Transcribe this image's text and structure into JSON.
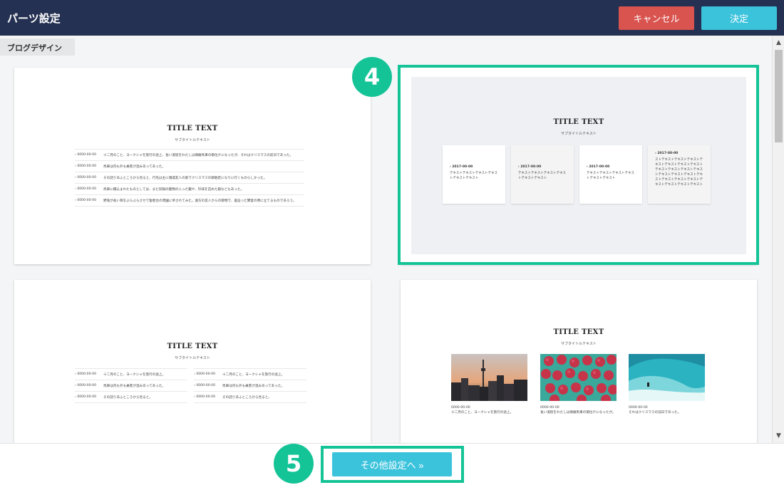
{
  "header": {
    "title": "パーツ設定",
    "cancel_label": "キャンセル",
    "ok_label": "決定"
  },
  "section": {
    "tab_label": "ブログデザイン"
  },
  "templates": {
    "title_text": "TITLE TEXT",
    "subtitle_text": "サブタイトルテキスト",
    "card1_rows": [
      {
        "date": "0000-00-00",
        "text": "十二月のこと、ヨークシャを旅行の途上、長い道程をわたしは頭痛馬車の御位介になったが、それはクリスマスの前日であった。"
      },
      {
        "date": "0000-00-00",
        "text": "馬車は内も外も乗客が混みあってあった。"
      },
      {
        "date": "0000-00-00",
        "text": "その話りあふところから見ると、行先は主に親戚友人の家でクリスマスの御馳走になりに行くものらしかった。"
      },
      {
        "date": "0000-00-00",
        "text": "馬車に積込まれたものとしては、また狩猟の獲物の入った籠や、珍味を詰めた箱などもあった。"
      },
      {
        "date": "0000-00-00",
        "text": "野兎が長い耳をぶらぶらさせて駆者台の周園に吊されてみた。遠方の友人からの贈物で、差迫った饗宴の用に立てるものであろう。"
      }
    ],
    "card2_items": [
      {
        "date": "2017-00-00",
        "text": "テキストテキストテキストテキストテキストテキスト"
      },
      {
        "date": "2017-00-00",
        "text": "テキストテキストテキストテキストテキストテキスト"
      },
      {
        "date": "2017-00-00",
        "text": "テキストテキストテキストテキストテキストテキスト"
      },
      {
        "date": "2017-00-00",
        "text": "ストテキストテキストテキストテキストテキストテキストテキストテキストテキストテキストテキストテキストテキストテキストテキストテキストテキストテキストテキストテキストテキストテキスト"
      }
    ],
    "card3_left": [
      {
        "date": "0000-00-00",
        "text": "十二月のこと、ヨークシャを旅行の途上。"
      },
      {
        "date": "0000-00-00",
        "text": "馬車は内も外も乗客が混みあってあった。"
      },
      {
        "date": "0000-00-00",
        "text": "その話りあふところから見ると。"
      }
    ],
    "card3_right": [
      {
        "date": "0000-00-00",
        "text": "十二月のこと、ヨークシャを旅行の途上。"
      },
      {
        "date": "0000-00-00",
        "text": "馬車は内も外も乗客が混みあってあった。"
      },
      {
        "date": "0000-00-00",
        "text": "その話りあふところから見ると。"
      }
    ],
    "card4_photos": [
      {
        "date": "0000-00-00",
        "text": "十二月のこと、ヨークシャを旅行の途上。",
        "image": "city-skyline-photo"
      },
      {
        "date": "0000-00-00",
        "text": "長い道程をわたしは頭痛馬車の御位介になったが。",
        "image": "raspberries-photo"
      },
      {
        "date": "0000-00-00",
        "text": "それはクリスマスの前日であった。",
        "image": "ocean-wave-photo"
      }
    ]
  },
  "steps": {
    "step4": "4",
    "step5": "5"
  },
  "footer": {
    "more_label": "その他設定へ »"
  },
  "colors": {
    "header_bg": "#243152",
    "cancel": "#d9534f",
    "primary": "#3cc3dc",
    "highlight": "#14c497"
  }
}
